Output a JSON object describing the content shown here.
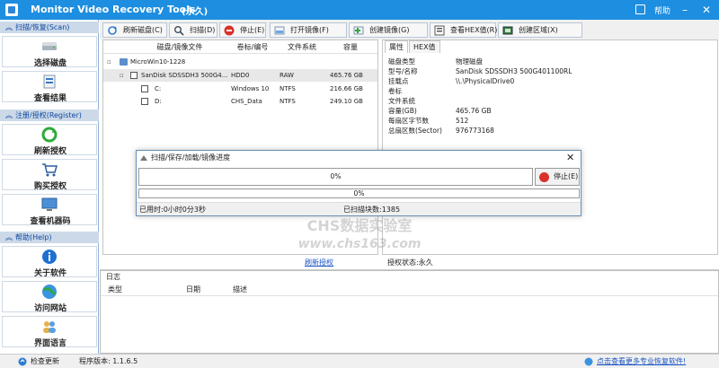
{
  "window": {
    "title": "Monitor Video Recovery Tools",
    "title_suffix": "(永久)",
    "help_label": "帮助",
    "minimize": "–",
    "close": "✕"
  },
  "sidebar": {
    "groups": [
      {
        "label": "扫描/恢复(Scan)"
      },
      {
        "label": "注册/授权(Register)"
      },
      {
        "label": "帮助(Help)"
      }
    ],
    "buttons": [
      {
        "label": "选择磁盘",
        "icon": "disk-icon"
      },
      {
        "label": "查看结果",
        "icon": "results-icon"
      },
      {
        "label": "刷新授权",
        "icon": "refresh-icon"
      },
      {
        "label": "购买授权",
        "icon": "cart-icon"
      },
      {
        "label": "查看机器码",
        "icon": "machine-code-icon"
      },
      {
        "label": "关于软件",
        "icon": "info-icon"
      },
      {
        "label": "访问网站",
        "icon": "globe-icon"
      },
      {
        "label": "界面语言",
        "icon": "language-icon"
      }
    ]
  },
  "toolbar": {
    "buttons": [
      {
        "label": "刷新磁盘(C)",
        "icon": "refresh-disk-icon"
      },
      {
        "label": "扫描(D)",
        "icon": "scan-icon"
      },
      {
        "label": "停止(E)",
        "icon": "stop-icon"
      },
      {
        "label": "打开镜像(F)",
        "icon": "open-image-icon"
      },
      {
        "label": "创建镜像(G)",
        "icon": "create-image-icon"
      },
      {
        "label": "查看HEX值(R)",
        "icon": "hex-icon"
      },
      {
        "label": "创建区域(X)",
        "icon": "region-icon"
      }
    ]
  },
  "disk_tree": {
    "columns": [
      "磁盘/镜像文件",
      "卷标/编号",
      "文件系统",
      "容量"
    ],
    "rows": [
      {
        "name": "MicroWin10-1228",
        "label": "",
        "fs": "",
        "size": ""
      },
      {
        "name": "SanDisk SDSSDH3 500G4...",
        "label": "HDD0",
        "fs": "RAW",
        "size": "465.76 GB"
      },
      {
        "name": "C:",
        "label": "Windows 10",
        "fs": "NTFS",
        "size": "216.66 GB"
      },
      {
        "name": "D:",
        "label": "CHS_Data",
        "fs": "NTFS",
        "size": "249.10 GB"
      }
    ]
  },
  "properties": {
    "tabs": [
      "属性",
      "HEX值"
    ],
    "rows": [
      {
        "key": "磁盘类型",
        "value": "物理磁盘"
      },
      {
        "key": "型号/名称",
        "value": "SanDisk SDSSDH3 500G401100RL"
      },
      {
        "key": "挂载点",
        "value": "\\\\.\\PhysicalDrive0"
      },
      {
        "key": "卷标",
        "value": ""
      },
      {
        "key": "文件系统",
        "value": ""
      },
      {
        "key": "容量(GB)",
        "value": "465.76 GB"
      },
      {
        "key": "每扇区字节数",
        "value": "512"
      },
      {
        "key": "总扇区数(Sector)",
        "value": "976773168"
      }
    ]
  },
  "progress_dialog": {
    "title": "扫描/保存/加载/镜像进度",
    "close": "✕",
    "bar1_text": "0%",
    "bar1_progress": 0,
    "bar2_text": "0%",
    "bar2_progress": 0,
    "stop_label": "停止(E)",
    "elapsed": "已用时:0小时0分3秒",
    "scanned": "已扫描块数:1385"
  },
  "watermark": {
    "line1": "CHS数据实验室",
    "line2": "www.chs163.com"
  },
  "info_strip": {
    "refresh_link": "刷新授权",
    "license_status": "授权状态:永久"
  },
  "log": {
    "title": "日志",
    "columns": [
      "类型",
      "日期",
      "描述"
    ]
  },
  "statusbar": {
    "check_update": "检查更新",
    "version": "程序版本:  1.1.6.5",
    "promo_link": "点击查看更多专业恢复软件!"
  },
  "colors": {
    "titlebar": "#1d8ee0",
    "sidebar_group": "#ccd9e8",
    "progress_fill": "#06b025",
    "link": "#1a55c4",
    "stop_red": "#d9312b"
  }
}
